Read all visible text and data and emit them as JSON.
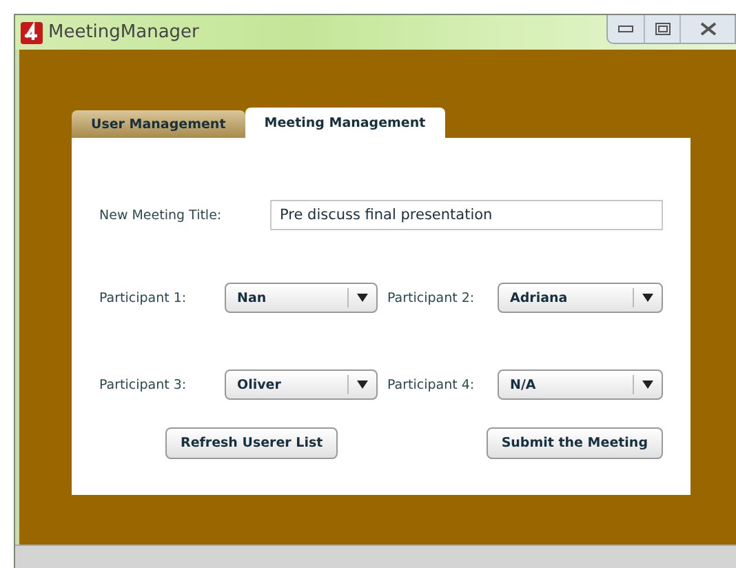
{
  "window": {
    "title": "MeetingManager"
  },
  "tabs": [
    {
      "label": "User Management",
      "selected": false
    },
    {
      "label": "Meeting Management",
      "selected": true
    }
  ],
  "title_field": {
    "label": "New Meeting Title:",
    "value": "Pre discuss final presentation"
  },
  "participants": [
    {
      "label": "Participant 1:",
      "value": "Nan"
    },
    {
      "label": "Participant 2:",
      "value": "Adriana"
    },
    {
      "label": "Participant 3:",
      "value": "Oliver"
    },
    {
      "label": "Participant 4:",
      "value": "N/A"
    }
  ],
  "buttons": [
    "Refresh Userer List",
    "Submit the Meeting"
  ]
}
